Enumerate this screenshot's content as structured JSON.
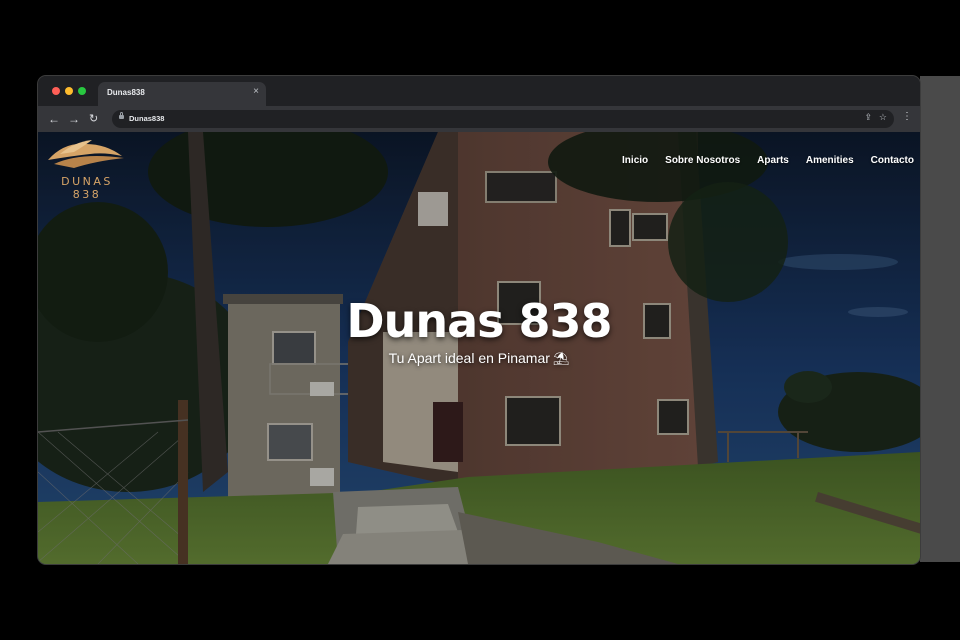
{
  "browser": {
    "tab_title": "Dunas838",
    "tab_close_icon": "×",
    "url": "Dunas838",
    "icons": {
      "back": "back-arrow-icon",
      "forward": "forward-arrow-icon",
      "reload": "reload-icon",
      "lock": "lock-icon",
      "share": "share-icon",
      "star": "bookmark-star-icon",
      "menu": "kebab-menu-icon"
    }
  },
  "site": {
    "logo_text": "DUNAS 838",
    "nav": [
      {
        "label": "Inicio"
      },
      {
        "label": "Sobre Nosotros"
      },
      {
        "label": "Aparts"
      },
      {
        "label": "Amenities"
      },
      {
        "label": "Contacto"
      }
    ],
    "hero": {
      "title": "Dunas 838",
      "subtitle": "Tu Apart ideal en Pinamar",
      "subtitle_icon": "beach-umbrella-icon"
    }
  },
  "colors": {
    "logo_gold": "#d6a467",
    "chrome_dark": "#202124",
    "chrome_toolbar": "#35363a"
  }
}
